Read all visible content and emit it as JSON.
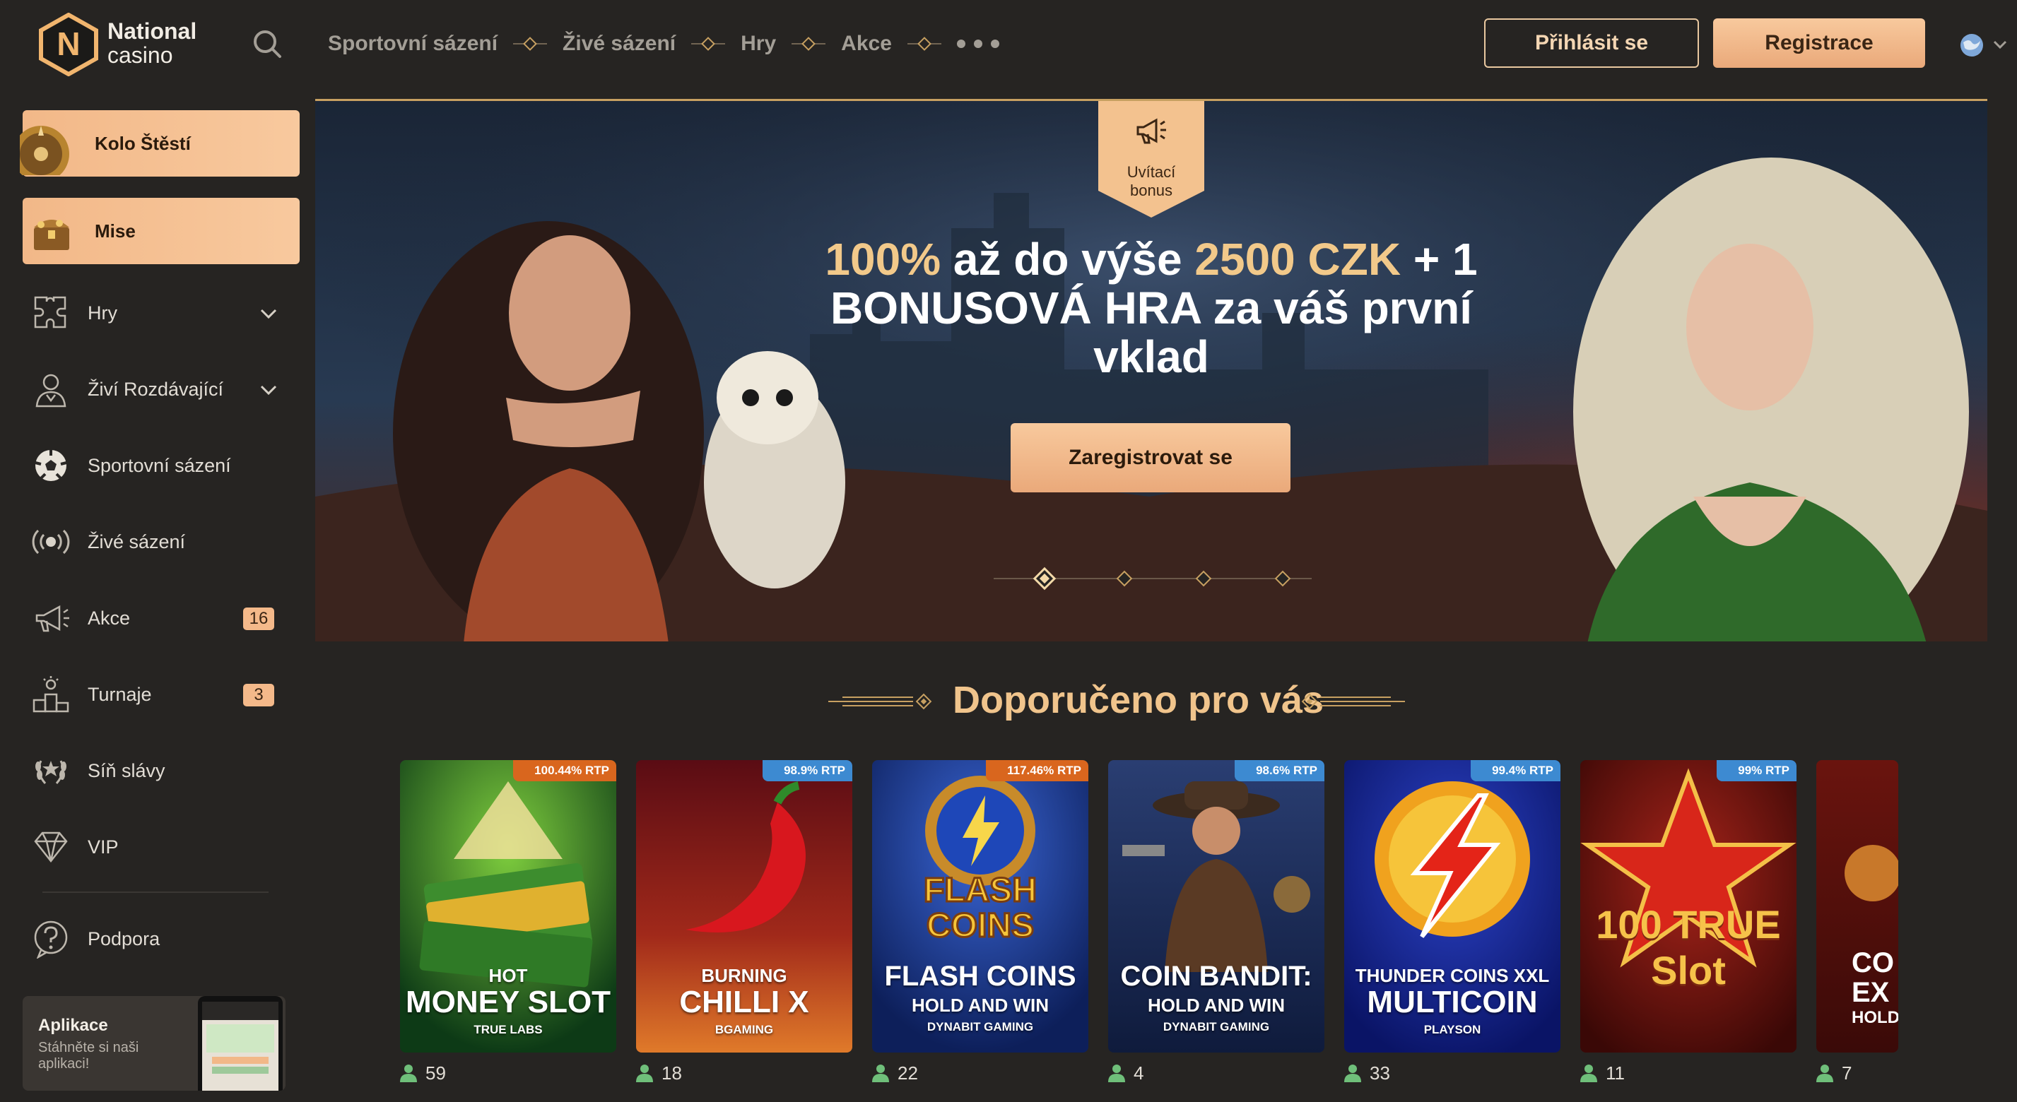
{
  "header": {
    "logo_line1": "National",
    "logo_line2": "casino",
    "nav": [
      "Sportovní sázení",
      "Živé sázení",
      "Hry",
      "Akce"
    ],
    "login": "Přihlásit se",
    "register": "Registrace"
  },
  "sidebar": {
    "promos": [
      {
        "label": "Kolo Štěstí",
        "icon": "wheel-icon"
      },
      {
        "label": "Mise",
        "icon": "treasure-chest-icon"
      }
    ],
    "items": [
      {
        "label": "Hry",
        "icon": "puzzle-icon",
        "expandable": true
      },
      {
        "label": "Živí Rozdávající",
        "icon": "dealer-icon",
        "expandable": true
      },
      {
        "label": "Sportovní sázení",
        "icon": "soccer-ball-icon"
      },
      {
        "label": "Živé sázení",
        "icon": "live-signal-icon"
      },
      {
        "label": "Akce",
        "icon": "megaphone-icon",
        "badge": "16"
      },
      {
        "label": "Turnaje",
        "icon": "podium-icon",
        "badge": "3"
      },
      {
        "label": "Síň slávy",
        "icon": "laurel-icon"
      },
      {
        "label": "VIP",
        "icon": "diamond-icon"
      },
      {
        "label": "Podpora",
        "icon": "help-icon"
      }
    ],
    "app": {
      "title": "Aplikace",
      "subtitle": "Stáhněte si naši aplikaci!"
    }
  },
  "hero": {
    "ribbon_line1": "Uvítací",
    "ribbon_line2": "bonus",
    "title_gold1": "100%",
    "title_mid": " až do výše ",
    "title_gold2": "2500 CZK",
    "title_rest": " + 1 BONUSOVÁ HRA za váš první vklad",
    "cta": "Zaregistrovat se",
    "slides": 4,
    "active_slide": 1
  },
  "section": {
    "title": "Doporučeno pro vás"
  },
  "games": [
    {
      "top": "HOT",
      "name": "MONEY SLOT",
      "provider": "TRUE LABS",
      "rtp": "100.44% RTP",
      "rtp_type": "hot",
      "players": "59",
      "bg": "green"
    },
    {
      "top": "BURNING",
      "name": "CHILLI X",
      "provider": "BGAMING",
      "rtp": "98.9% RTP",
      "rtp_type": "cold",
      "players": "18",
      "bg": "chilli"
    },
    {
      "top": "",
      "name": "FLASH COINS",
      "sub": "HOLD AND WIN",
      "provider": "DYNABIT GAMING",
      "rtp": "117.46% RTP",
      "rtp_type": "hot",
      "players": "22",
      "bg": "blue"
    },
    {
      "top": "",
      "name": "COIN BANDIT:",
      "sub": "HOLD AND WIN",
      "provider": "DYNABIT GAMING",
      "rtp": "98.6% RTP",
      "rtp_type": "cold",
      "players": "4",
      "bg": "night"
    },
    {
      "top": "THUNDER COINS XXL",
      "name": "MULTICOIN",
      "provider": "PLAYSON",
      "rtp": "99.4% RTP",
      "rtp_type": "cold",
      "players": "33",
      "bg": "royal"
    },
    {
      "top": "",
      "name": "100 TRUE Slot",
      "provider": "",
      "rtp": "99% RTP",
      "rtp_type": "cold",
      "players": "11",
      "bg": "red"
    },
    {
      "top": "",
      "name": "CO EX HOLD",
      "provider": "",
      "rtp": "",
      "rtp_type": "",
      "players": "7",
      "bg": "partial"
    }
  ]
}
